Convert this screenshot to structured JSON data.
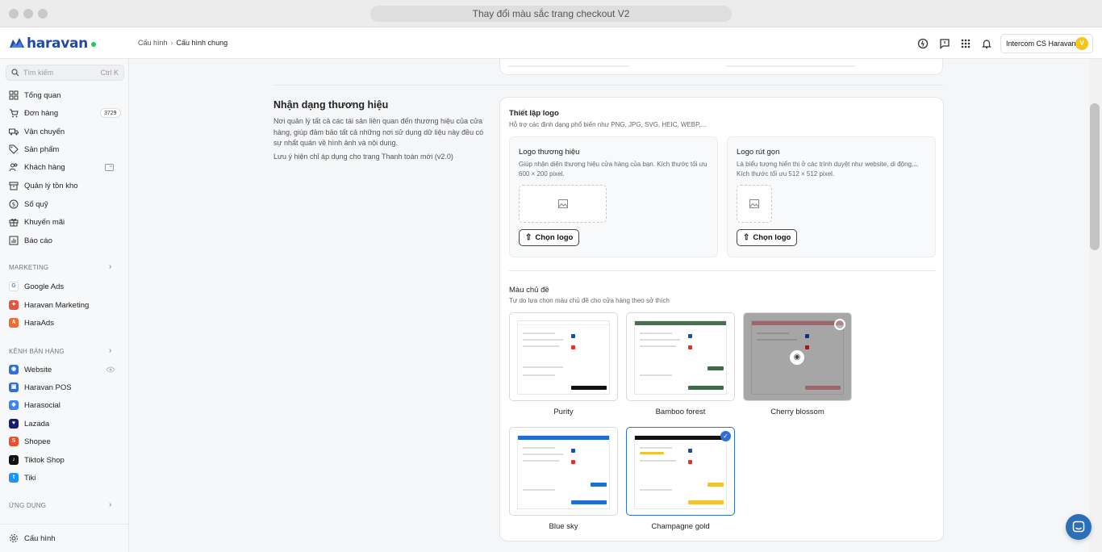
{
  "browser": {
    "title": "Thay đổi màu sắc trang checkout V2"
  },
  "header": {
    "brand": "haravan",
    "breadcrumb": [
      "Cấu hình",
      "Cấu hình chung"
    ],
    "account_name": "Intercom CS Haravan",
    "avatar_letter": "V"
  },
  "sidebar": {
    "search_placeholder": "Tìm kiếm",
    "search_shortcut": "Ctrl K",
    "items": [
      {
        "label": "Tổng quan",
        "icon": "dashboard-icon"
      },
      {
        "label": "Đơn hàng",
        "icon": "cart-icon",
        "badge": "3729"
      },
      {
        "label": "Vận chuyển",
        "icon": "truck-icon"
      },
      {
        "label": "Sản phẩm",
        "icon": "tag-icon"
      },
      {
        "label": "Khách hàng",
        "icon": "users-icon"
      },
      {
        "label": "Quản lý tồn kho",
        "icon": "box-icon"
      },
      {
        "label": "Sổ quỹ",
        "icon": "coin-icon"
      },
      {
        "label": "Khuyến mãi",
        "icon": "gift-icon"
      },
      {
        "label": "Báo cáo",
        "icon": "chart-icon"
      }
    ],
    "marketing_label": "MARKETING",
    "marketing_items": [
      {
        "label": "Google Ads",
        "color": "#ffffff"
      },
      {
        "label": "Haravan Marketing",
        "color": "#e2553f"
      },
      {
        "label": "HaraAds",
        "color": "#f26b2a"
      }
    ],
    "channels_label": "KÊNH BÁN HÀNG",
    "channel_items": [
      {
        "label": "Website",
        "color": "#2f6fd6"
      },
      {
        "label": "Haravan POS",
        "color": "#2f6fd6"
      },
      {
        "label": "Harasocial",
        "color": "#3b82f6"
      },
      {
        "label": "Lazada",
        "color": "#1a1a6e"
      },
      {
        "label": "Shopee",
        "color": "#ee4d2d"
      },
      {
        "label": "Tiktok Shop",
        "color": "#111111"
      },
      {
        "label": "Tiki",
        "color": "#1a94ff"
      }
    ],
    "apps_label": "ỨNG DỤNG",
    "settings_label": "Cấu hình"
  },
  "brand_section": {
    "title": "Nhận dạng thương hiệu",
    "description": "Nơi quản lý tất cả các tài sản liên quan đến thương hiệu của cửa hàng, giúp đảm bảo tất cả những nơi sử dụng dữ liệu này đều có sự nhất quán về hình ảnh và nội dung.",
    "note": "Lưu ý hiện chỉ áp dụng cho trang Thanh toán mới (v2.0)",
    "logo_setup": {
      "title": "Thiết lập logo",
      "subtitle": "Hỗ trợ các định dạng phổ biến như PNG, JPG, SVG, HEIC, WEBP,...",
      "brand_logo": {
        "title": "Logo thương hiệu",
        "desc": "Giúp nhận diện thương hiệu cửa hàng của bạn. Kích thước tối ưu 600 × 200 pixel.",
        "button": "Chọn logo"
      },
      "short_logo": {
        "title": "Logo rút gọn",
        "desc": "Là biểu tượng hiển thị ở các trình duyệt như website, di động,... Kích thước tối ưu 512 × 512 pixel.",
        "button": "Chọn logo"
      }
    },
    "theme": {
      "title": "Màu chủ đề",
      "subtitle": "Tự do lựa chọn màu chủ đề cho cửa hàng theo sở thích",
      "options": [
        {
          "name": "Purity",
          "accent": "#111111",
          "bar": "#ffffff",
          "selected": false
        },
        {
          "name": "Bamboo forest",
          "accent": "#3f6b4a",
          "bar": "#4b6e52",
          "selected": false
        },
        {
          "name": "Cherry blossom",
          "accent": "#e8a1a8",
          "bar": "#e8a1a8",
          "selected": false,
          "hovered": true
        },
        {
          "name": "Blue sky",
          "accent": "#1f6fd1",
          "bar": "#1f6fd1",
          "selected": false
        },
        {
          "name": "Champagne gold",
          "accent": "#f2c230",
          "bar": "#111111",
          "selected": true
        }
      ]
    }
  }
}
